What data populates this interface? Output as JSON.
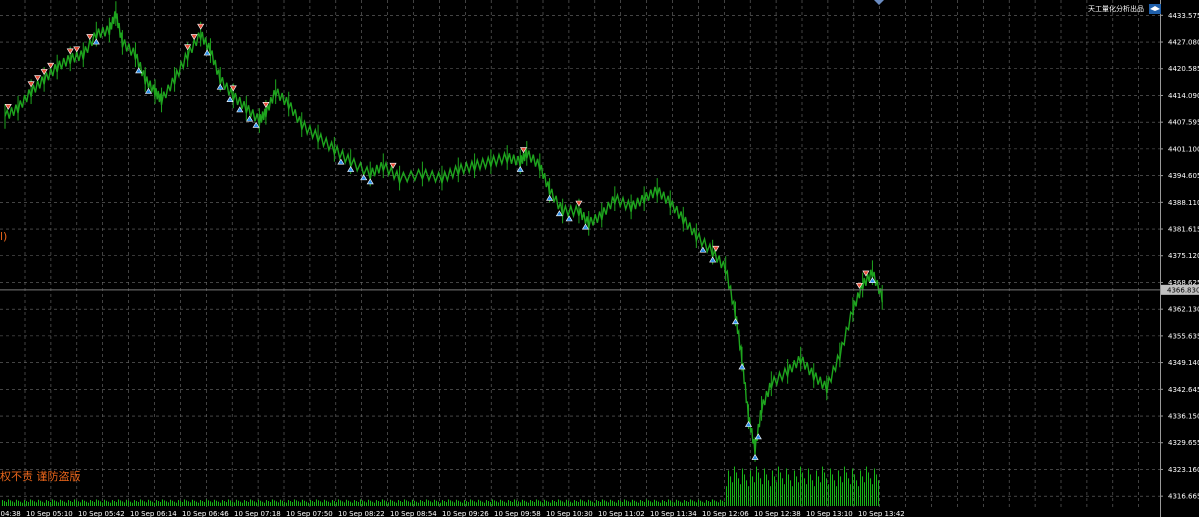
{
  "header": {
    "brand_text": "天工量化分析出品"
  },
  "watermark": {
    "left_fragment": "l)",
    "bottom_text": "权不责 谨防盗版"
  },
  "colors": {
    "background": "#000000",
    "grid": "#6e6e6e",
    "price_line": "#1ea51e",
    "volume": "#17b417",
    "sell_marker": "#e8503a",
    "buy_marker": "#2f8fe8",
    "current_price_line": "#7a7a7a",
    "watermark": "#e8641a"
  },
  "icons": {
    "scroll_arrow": "triangle-down-icon",
    "brand_logo": "graduation-cap-icon"
  },
  "chart_data": {
    "type": "line",
    "title": "",
    "y_axis_ticks": [
      "4433.575",
      "4427.080",
      "4420.585",
      "4414.090",
      "4407.595",
      "4401.100",
      "4394.605",
      "4388.110",
      "4381.615",
      "4375.120",
      "4368.625",
      "4362.130",
      "4355.635",
      "4349.140",
      "4342.645",
      "4336.150",
      "4329.655",
      "4323.160",
      "4316.665"
    ],
    "ylim": [
      4313.3,
      4437.3
    ],
    "current_price": "4366.830",
    "x_axis_ticks": [
      "10 Sep 04:38",
      "10 Sep 05:10",
      "10 Sep 05:42",
      "10 Sep 06:14",
      "10 Sep 06:46",
      "10 Sep 07:18",
      "10 Sep 07:50",
      "10 Sep 08:22",
      "10 Sep 08:54",
      "10 Sep 09:26",
      "10 Sep 09:58",
      "10 Sep 10:30",
      "10 Sep 11:02",
      "10 Sep 11:34",
      "10 Sep 12:06",
      "10 Sep 12:38",
      "10 Sep 13:10",
      "10 Sep 13:42"
    ],
    "series": [
      {
        "kind": "price",
        "points": [
          [
            "04:38",
            4409
          ],
          [
            "04:46",
            4411
          ],
          [
            "04:54",
            4415
          ],
          [
            "05:02",
            4418
          ],
          [
            "05:10",
            4421
          ],
          [
            "05:18",
            4423
          ],
          [
            "05:26",
            4424
          ],
          [
            "05:34",
            4429
          ],
          [
            "05:42",
            4430
          ],
          [
            "05:46",
            4434
          ],
          [
            "05:50",
            4427
          ],
          [
            "05:58",
            4424
          ],
          [
            "06:04",
            4418
          ],
          [
            "06:10",
            4415
          ],
          [
            "06:14",
            4413
          ],
          [
            "06:22",
            4418
          ],
          [
            "06:30",
            4424
          ],
          [
            "06:38",
            4429
          ],
          [
            "06:44",
            4425
          ],
          [
            "06:50",
            4418
          ],
          [
            "06:58",
            4414
          ],
          [
            "07:06",
            4411
          ],
          [
            "07:14",
            4408
          ],
          [
            "07:18",
            4410
          ],
          [
            "07:24",
            4415
          ],
          [
            "07:32",
            4412
          ],
          [
            "07:40",
            4407
          ],
          [
            "07:50",
            4404
          ],
          [
            "08:00",
            4401
          ],
          [
            "08:10",
            4398
          ],
          [
            "08:22",
            4395
          ],
          [
            "08:30",
            4397
          ],
          [
            "08:40",
            4394
          ],
          [
            "08:54",
            4395
          ],
          [
            "09:06",
            4394
          ],
          [
            "09:16",
            4396
          ],
          [
            "09:26",
            4397
          ],
          [
            "09:36",
            4398
          ],
          [
            "09:46",
            4399
          ],
          [
            "09:54",
            4398
          ],
          [
            "09:58",
            4400
          ],
          [
            "10:06",
            4397
          ],
          [
            "10:12",
            4391
          ],
          [
            "10:20",
            4386
          ],
          [
            "10:30",
            4386
          ],
          [
            "10:36",
            4383
          ],
          [
            "10:44",
            4385
          ],
          [
            "10:52",
            4389
          ],
          [
            "11:02",
            4387
          ],
          [
            "11:10",
            4389
          ],
          [
            "11:18",
            4391
          ],
          [
            "11:26",
            4388
          ],
          [
            "11:34",
            4384
          ],
          [
            "11:42",
            4380
          ],
          [
            "11:52",
            4376
          ],
          [
            "12:00",
            4372
          ],
          [
            "12:06",
            4361
          ],
          [
            "12:10",
            4350
          ],
          [
            "12:14",
            4336
          ],
          [
            "12:18",
            4328
          ],
          [
            "12:22",
            4338
          ],
          [
            "12:28",
            4344
          ],
          [
            "12:38",
            4347
          ],
          [
            "12:46",
            4350
          ],
          [
            "12:54",
            4346
          ],
          [
            "13:02",
            4343
          ],
          [
            "13:10",
            4351
          ],
          [
            "13:18",
            4362
          ],
          [
            "13:24",
            4368
          ],
          [
            "13:30",
            4371
          ],
          [
            "13:36",
            4365
          ]
        ]
      },
      {
        "kind": "volume",
        "note": "low baseline until ~12:00, then elevated",
        "level_before_1200": 0.1,
        "level_after_1200": 0.6
      }
    ],
    "markers": {
      "sell": [
        "04:40",
        "04:54",
        "04:58",
        "05:02",
        "05:06",
        "05:18",
        "05:22",
        "05:30",
        "06:30",
        "06:34",
        "06:38",
        "06:58",
        "07:18",
        "08:36",
        "09:56",
        "10:30",
        "11:54",
        "13:22",
        "13:26"
      ],
      "buy": [
        "05:34",
        "06:00",
        "06:06",
        "06:42",
        "06:50",
        "06:56",
        "07:02",
        "07:08",
        "07:12",
        "08:04",
        "08:10",
        "08:18",
        "08:22",
        "09:54",
        "10:12",
        "10:18",
        "10:24",
        "10:34",
        "11:46",
        "11:52",
        "12:06",
        "12:10",
        "12:14",
        "12:18",
        "12:20",
        "13:30"
      ]
    },
    "grid": true
  }
}
